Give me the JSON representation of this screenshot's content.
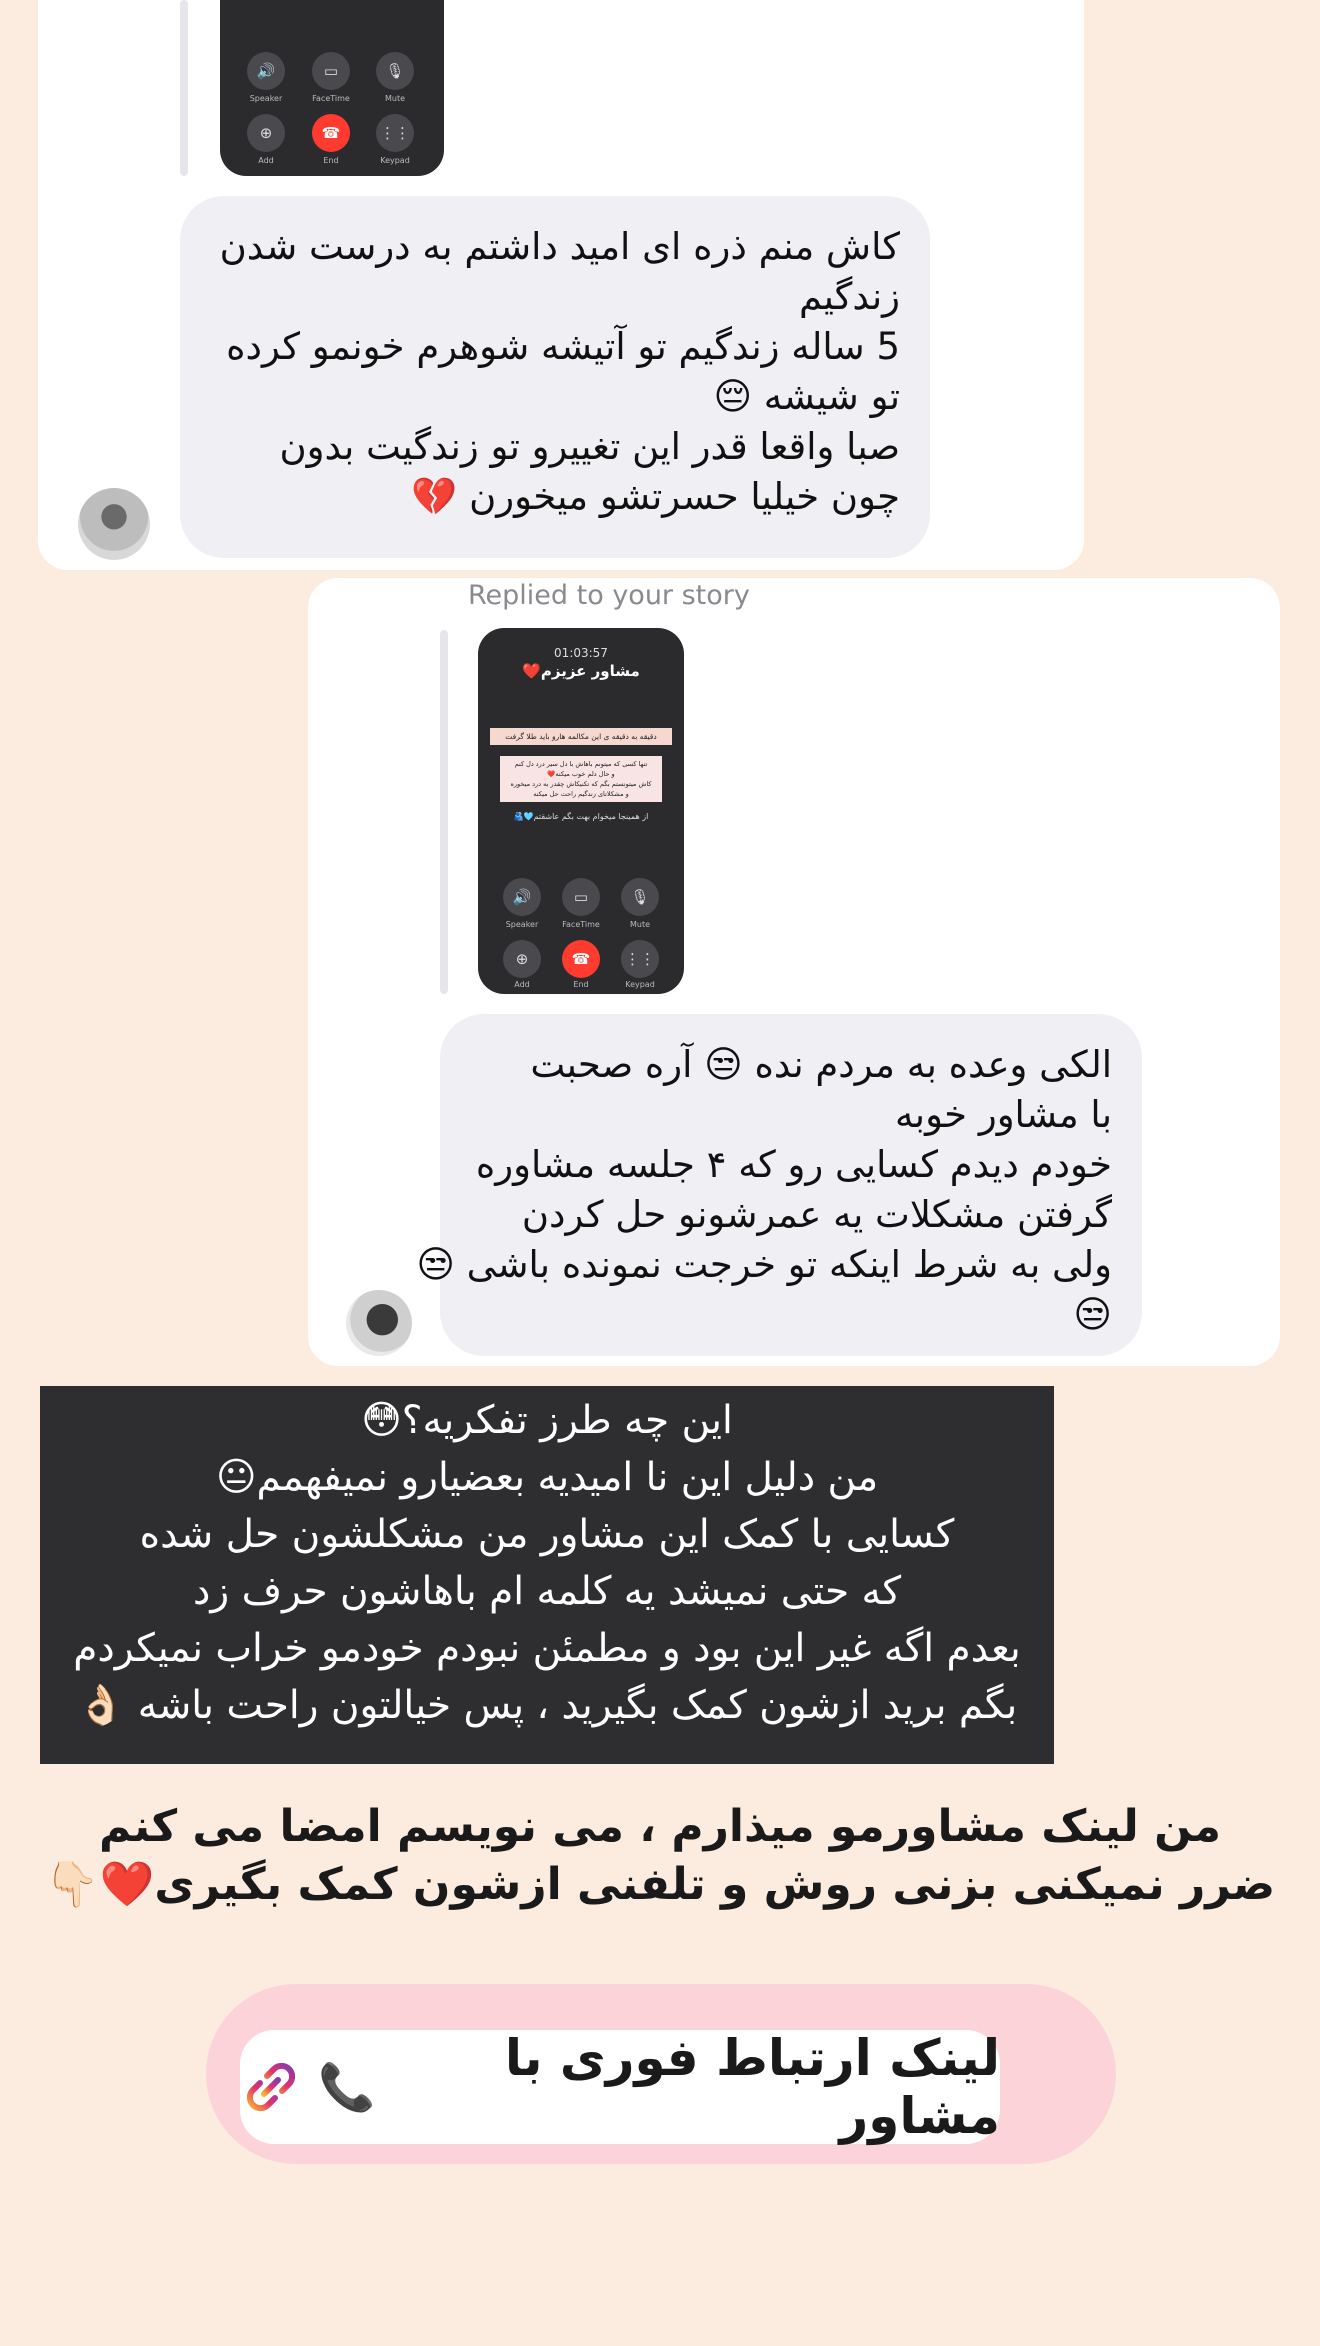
{
  "message1": {
    "lines": [
      "کاش منم ذره ای امید داشتم به درست شدن",
      "زندگیم",
      "5 ساله زندگیم تو آتیشه شوهرم خونمو کرده",
      "تو شیشه 😔",
      "صبا واقعا قدر این تغییرو تو زندگیت بدون",
      "چون خیلیا حسرتشو میخورن 💔"
    ],
    "thumb_buttons": [
      "Speaker",
      "FaceTime",
      "Mute",
      "Add",
      "End",
      "Keypad"
    ]
  },
  "message2": {
    "replied_label": "Replied to your story",
    "thumb": {
      "time": "01:03:57",
      "title": "مشاور عزیزم❤️",
      "banner": "دقیقه به دقیقه ی این مکالمه هارو باید طلا گرفت",
      "text_lines": [
        "تنها کسی که میتونم باهاش با دل سیر درد دل کنم",
        "و حال دلم خوب میکنه❤️",
        "کاش میتونستم بگم که تکنیکاش چقدر به درد میخوره",
        "و مشکلاتای زندگیم راحت حل میکنه"
      ],
      "footer": "از همینجا میخوام بهت بگم عاشقتم🩵🫂",
      "buttons": [
        "Speaker",
        "FaceTime",
        "Mute",
        "Add",
        "End",
        "Keypad"
      ]
    },
    "lines": [
      "الکی وعده به مردم نده 😒 آره صحبت",
      "با مشاور خوبه",
      "خودم دیدم کسایی رو که ۴ جلسه مشاوره",
      "گرفتن مشکلات یه عمرشونو حل کردن",
      "ولی به شرط اینکه تو خرجت نمونده باشی 😒",
      "😒"
    ]
  },
  "overlay_text": [
    "این چه طرز تفکریه؟😳",
    "من دلیل این نا امیدیه بعضیارو نمیفهمم😐",
    "کسایی با کمک این مشاور من مشکلشون حل شده",
    "که حتی نمیشد یه کلمه ام باهاشون حرف زد",
    "بعدم اگه غیر این بود و مطمئن نبودم خودمو خراب نمیکردم",
    "بگم برید ازشون کمک بگیرید ، پس خیالتون راحت باشه 👌🏻"
  ],
  "caption": [
    "من لینک مشاورمو میذارم ، می نویسم امضا می کنم",
    "ضرر نمیکنی بزنی روش و تلفنی ازشون کمک بگیری❤️👇🏻"
  ],
  "link_sticker": {
    "label": "لینک ارتباط فوری با مشاور",
    "phone_emoji": "📞",
    "link_icon": "link-icon",
    "gradient_colors": [
      "#f9b233",
      "#e1306c",
      "#833ab4"
    ]
  }
}
